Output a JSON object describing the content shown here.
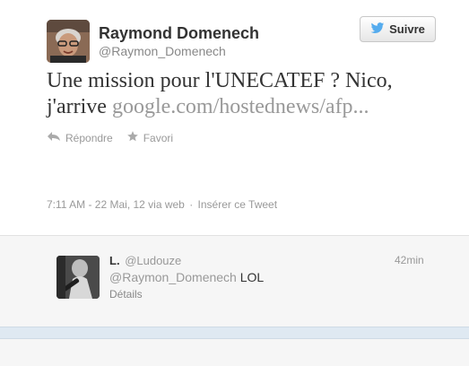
{
  "tweet": {
    "author_name": "Raymond Domenech",
    "author_handle": "@Raymon_Domenech",
    "follow_label": "Suivre",
    "text": "Une mission pour l'UNECATEF ? Nico, j'arrive",
    "link": "google.com/hostednews/afp...",
    "actions": {
      "reply": "Répondre",
      "favorite": "Favori"
    },
    "timestamp": "7:11 AM - 22 Mai, 12 via web",
    "separator": "·",
    "embed": "Insérer ce Tweet"
  },
  "reply": {
    "author_name": "L.",
    "author_handle": "@Ludouze",
    "time": "42min",
    "mention": "@Raymon_Domenech",
    "text": "LOL",
    "details": "Détails"
  },
  "colors": {
    "twitter_blue": "#55acee",
    "link_gray": "#999999",
    "band_blue": "#dfe9f2"
  },
  "icons": {
    "follow": "twitter-bird-icon",
    "reply": "reply-arrow-icon",
    "favorite": "star-icon"
  }
}
